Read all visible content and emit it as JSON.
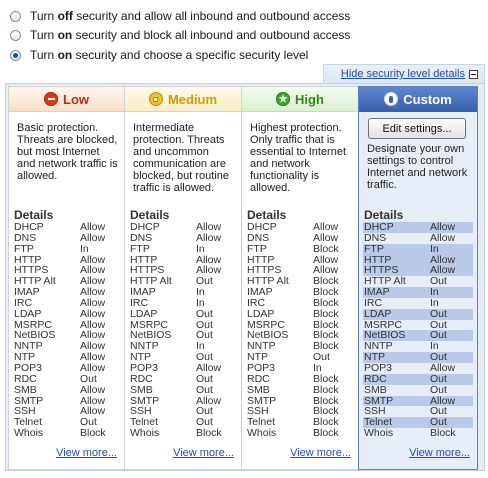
{
  "options": [
    {
      "pre": "Turn ",
      "bold": "off",
      "post": " security and allow all inbound and outbound access",
      "checked": false
    },
    {
      "pre": "Turn ",
      "bold": "on",
      "post": " security and block all inbound and outbound access",
      "checked": false
    },
    {
      "pre": "Turn ",
      "bold": "on",
      "post": " security and choose a specific security level",
      "checked": true
    }
  ],
  "hide_link": "Hide security level details",
  "ports": [
    "DHCP",
    "DNS",
    "FTP",
    "HTTP",
    "HTTPS",
    "HTTP Alt",
    "IMAP",
    "IRC",
    "LDAP",
    "MSRPC",
    "NetBIOS",
    "NNTP",
    "NTP",
    "POP3",
    "RDC",
    "SMB",
    "SMTP",
    "SSH",
    "Telnet",
    "Whois"
  ],
  "levels": {
    "low": {
      "title": "Low",
      "description": "Basic protection. Threats are blocked, but most Internet and network traffic is allowed.",
      "details_label": "Details",
      "values": [
        "Allow",
        "Allow",
        "In",
        "Allow",
        "Allow",
        "Allow",
        "Allow",
        "Allow",
        "Allow",
        "Allow",
        "Allow",
        "Allow",
        "Allow",
        "Allow",
        "Out",
        "Allow",
        "Allow",
        "Allow",
        "Out",
        "Block"
      ],
      "view_more": "View more..."
    },
    "medium": {
      "title": "Medium",
      "description": "Intermediate protection. Threats and uncommon communication are blocked, but routine traffic is allowed.",
      "details_label": "Details",
      "values": [
        "Allow",
        "Allow",
        "In",
        "Allow",
        "Allow",
        "Out",
        "In",
        "In",
        "Out",
        "Out",
        "Out",
        "In",
        "Out",
        "Allow",
        "Out",
        "Out",
        "Allow",
        "Out",
        "Out",
        "Block"
      ],
      "view_more": "View more..."
    },
    "high": {
      "title": "High",
      "description": "Highest protection. Only traffic that is essential to Internet and network functionality is allowed.",
      "details_label": "Details",
      "values": [
        "Allow",
        "Allow",
        "Block",
        "Allow",
        "Allow",
        "Block",
        "Block",
        "Block",
        "Block",
        "Block",
        "Block",
        "Block",
        "Out",
        "In",
        "Block",
        "Block",
        "Block",
        "Block",
        "Block",
        "Block"
      ],
      "view_more": "View more..."
    },
    "custom": {
      "title": "Custom",
      "edit_button": "Edit settings...",
      "description": "Designate your own settings to control Internet and network traffic.",
      "details_label": "Details",
      "values": [
        "Allow",
        "Allow",
        "In",
        "Allow",
        "Allow",
        "Out",
        "In",
        "In",
        "Out",
        "Out",
        "Out",
        "In",
        "Out",
        "Allow",
        "Out",
        "Out",
        "Allow",
        "Out",
        "Out",
        "Block"
      ],
      "highlighted": [
        true,
        false,
        true,
        true,
        true,
        false,
        true,
        false,
        true,
        false,
        true,
        false,
        true,
        false,
        true,
        false,
        true,
        false,
        true,
        false
      ],
      "view_more": "View more..."
    }
  }
}
